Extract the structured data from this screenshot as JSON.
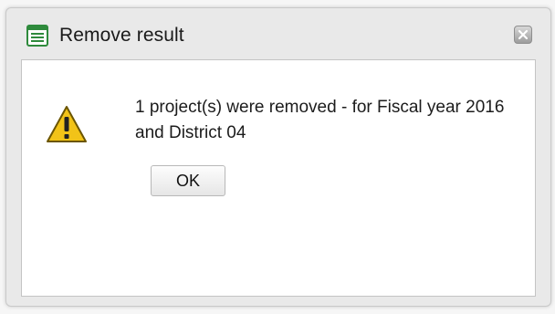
{
  "dialog": {
    "title": "Remove result",
    "title_icon": "list-document-icon",
    "close_icon": "close-icon",
    "warning_icon": "warning-triangle-icon",
    "message": "1 project(s) were removed - for Fiscal year 2016 and District 04",
    "ok_label": "OK"
  },
  "colors": {
    "title_icon_green": "#2e8a3c",
    "warning_yellow": "#f2c318",
    "warning_border": "#6b5500"
  }
}
